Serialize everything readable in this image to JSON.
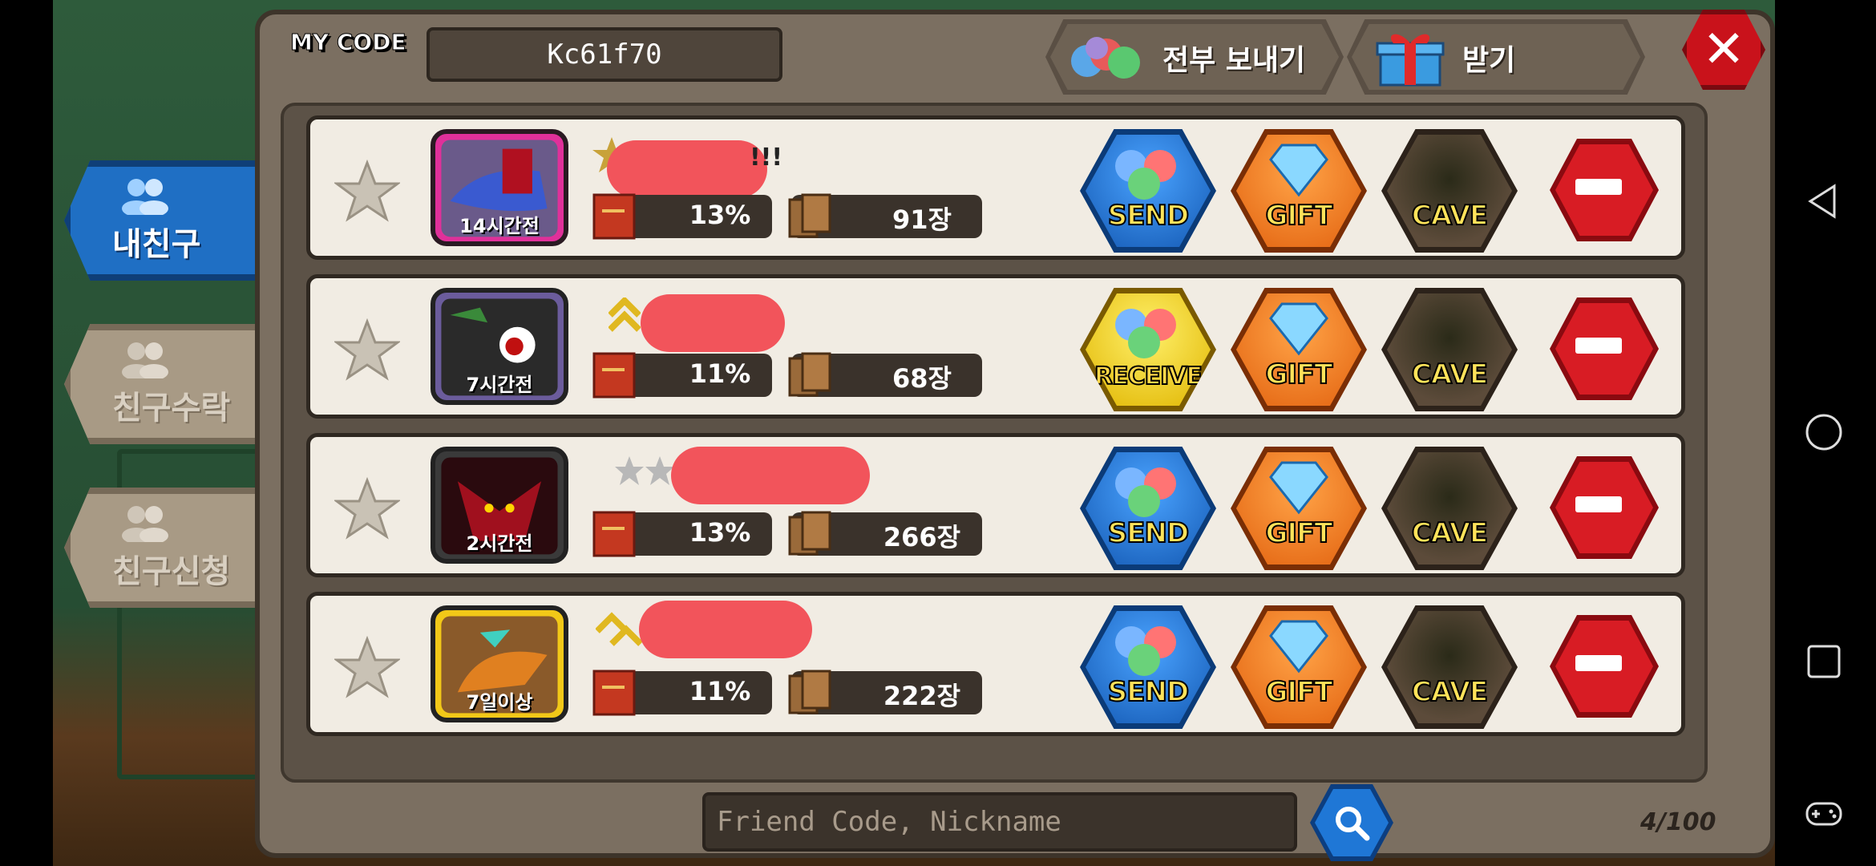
{
  "my_code_label": "MY CODE",
  "my_code": "Kc61f70",
  "send_all_label": "전부 보내기",
  "receive_label": "받기",
  "side_tabs": [
    {
      "label": "내친구",
      "active": true
    },
    {
      "label": "친구수락",
      "active": false
    },
    {
      "label": "친구신청",
      "active": false
    }
  ],
  "friends": [
    {
      "time": "14시간전",
      "percent": "13%",
      "cards": "91장",
      "name_visible": "!!!",
      "action": "SEND",
      "rank_icon": "star-rank-icon"
    },
    {
      "time": "7시간전",
      "percent": "11%",
      "cards": "68장",
      "name_visible": "",
      "action": "RECEIVE",
      "rank_icon": "chevron-rank-icon"
    },
    {
      "time": "2시간전",
      "percent": "13%",
      "cards": "266장",
      "name_visible": "",
      "action": "SEND",
      "rank_icon": "silver-star-rank-icon"
    },
    {
      "time": "7일이상",
      "percent": "11%",
      "cards": "222장",
      "name_visible": "",
      "action": "SEND",
      "rank_icon": "chevron-rank-icon"
    }
  ],
  "gift_label": "GIFT",
  "cave_label": "CAVE",
  "search": {
    "placeholder": "Friend Code, Nickname"
  },
  "friend_count": "4/100",
  "colors": {
    "active_tab": "#1f6fc4",
    "send": "#1459b3",
    "receive": "#e0b500",
    "gift": "#e2620f",
    "remove": "#d81c24"
  }
}
